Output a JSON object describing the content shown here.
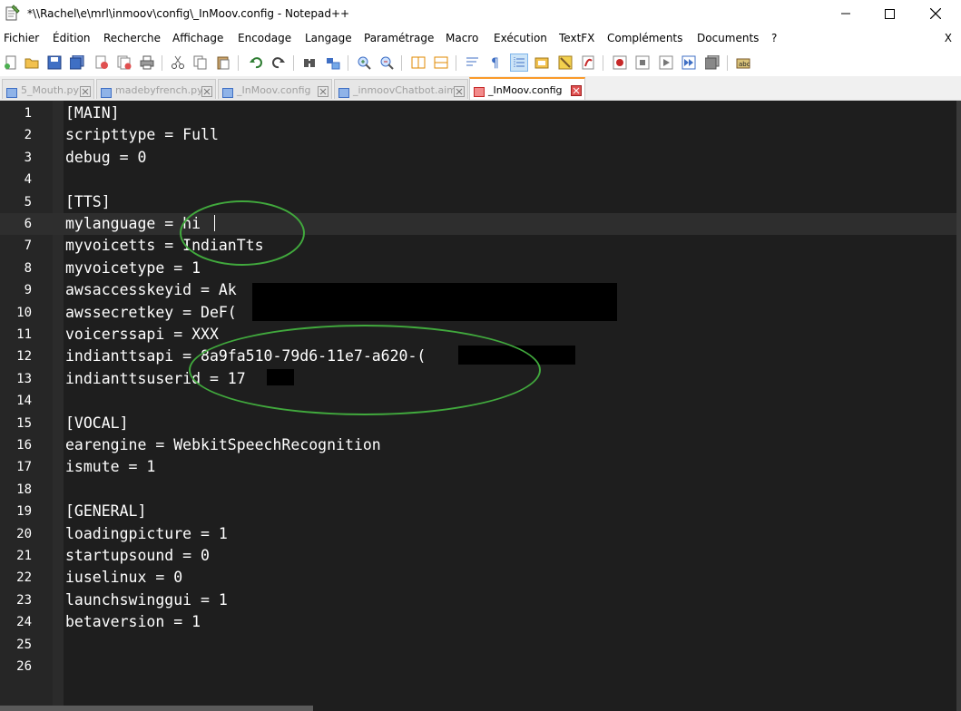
{
  "window": {
    "title": "*\\\\Rachel\\e\\mrl\\inmoov\\config\\_InMoov.config - Notepad++"
  },
  "menu": {
    "items": [
      "Fichier",
      "Édition",
      "Recherche",
      "Affichage",
      "Encodage",
      "Langage",
      "Paramétrage",
      "Macro",
      "Exécution",
      "TextFX",
      "Compléments",
      "Documents",
      "?"
    ],
    "close_label": "X"
  },
  "toolbar": {
    "buttons": [
      "new-file-icon",
      "open-file-icon",
      "save-icon",
      "save-all-icon",
      "close-icon",
      "close-all-icon",
      "print-icon",
      "cut-icon",
      "copy-icon",
      "paste-icon",
      "undo-icon",
      "redo-icon",
      "find-icon",
      "replace-icon",
      "zoom-in-icon",
      "zoom-out-icon",
      "sync-vertical-icon",
      "sync-horizontal-icon",
      "word-wrap-icon",
      "show-all-chars-icon",
      "indent-guide-icon",
      "doc-map-icon",
      "function-list-icon",
      "folder-workspace-icon",
      "record-macro-icon",
      "stop-macro-icon",
      "play-macro-icon",
      "run-macro-multiple-icon",
      "save-macro-icon",
      "spell-check-icon"
    ]
  },
  "tabs": [
    {
      "label": "5_Mouth.py",
      "active": false
    },
    {
      "label": "madebyfrench.py",
      "active": false
    },
    {
      "label": "_InMoov.config",
      "active": false
    },
    {
      "label": "_inmoovChatbot.aiml",
      "active": false
    },
    {
      "label": "_InMoov.config",
      "active": true
    }
  ],
  "editor": {
    "current_line": 6,
    "lines": [
      "[MAIN]",
      "scripttype = Full",
      "debug = 0",
      "",
      "[TTS]",
      "mylanguage = hi",
      "myvoicetts = IndianTts",
      "myvoicetype = 1",
      "awsaccesskeyid = Ak",
      "awssecretkey = DeF(",
      "voicerssapi = XXX",
      "indianttsapi = 8a9fa510-79d6-11e7-a620-(",
      "indianttsuserid = 17",
      "",
      "[VOCAL]",
      "earengine = WebkitSpeechRecognition",
      "ismute = 1",
      "",
      "[GENERAL]",
      "loadingpicture = 1",
      "startupsound = 0",
      "iuselinux = 0",
      "launchswinggui = 1",
      "betaversion = 1",
      "",
      ""
    ]
  },
  "colors": {
    "editor_bg": "#1e1e1e",
    "gutter_bg": "#262626",
    "annotation_circle": "#41a93d",
    "active_tab_accent": "#fa9a2a"
  }
}
